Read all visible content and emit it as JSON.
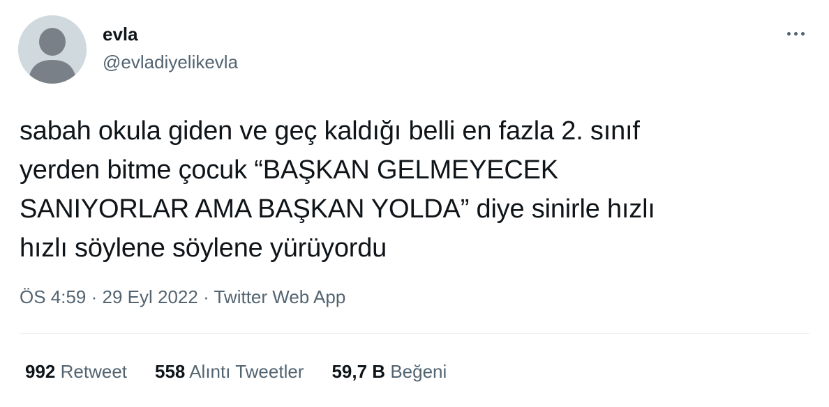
{
  "user": {
    "display_name": "evla",
    "handle": "@evladiyelikevla"
  },
  "tweet": {
    "text": "sabah okula giden ve geç kaldığı belli en fazla 2. sınıf\nyerden bitme çocuk “BAŞKAN GELMEYECEK\nSANIYORLAR AMA BAŞKAN YOLDA” diye sinirle hızlı\nhızlı söylene söylene yürüyordu"
  },
  "meta": {
    "time": "ÖS 4:59",
    "separator1": " · ",
    "date": "29 Eyl 2022",
    "separator2": " · ",
    "source": "Twitter Web App"
  },
  "stats": {
    "retweets": {
      "value": "992",
      "label": "Retweet"
    },
    "quotes": {
      "value": "558",
      "label": "Alıntı Tweetler"
    },
    "likes": {
      "value": "59,7 B",
      "label": "Beğeni"
    }
  },
  "icons": {
    "avatar": "default-avatar-icon",
    "more": "more-icon"
  },
  "colors": {
    "text": "#0f1419",
    "secondary": "#536471",
    "avatar_bg": "#cfd9de",
    "avatar_fg": "#7a8087",
    "divider": "#eff3f4"
  }
}
